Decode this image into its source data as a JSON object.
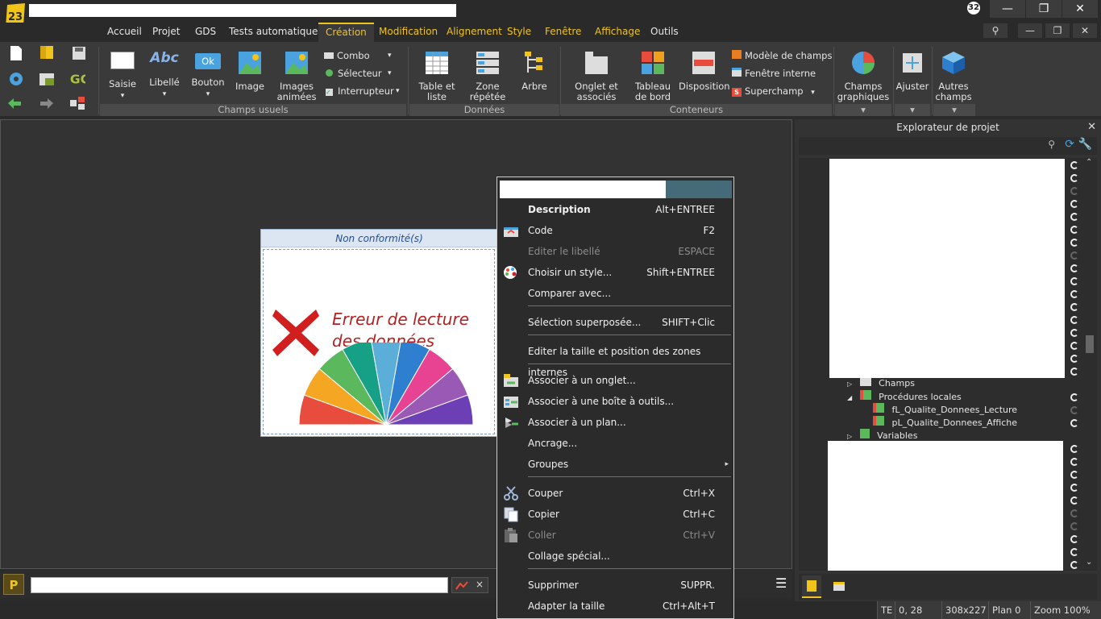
{
  "titlebar": {
    "logo_text": "23",
    "notification_count": "32"
  },
  "menu": {
    "tabs": [
      {
        "label": "Accueil",
        "style": "normal"
      },
      {
        "label": "Projet",
        "style": "normal"
      },
      {
        "label": "GDS",
        "style": "normal"
      },
      {
        "label": "Tests automatiques",
        "style": "normal"
      },
      {
        "label": "Création",
        "style": "active"
      },
      {
        "label": "Modification",
        "style": "yellow"
      },
      {
        "label": "Alignement",
        "style": "yellow"
      },
      {
        "label": "Style",
        "style": "yellow"
      },
      {
        "label": "Fenêtre",
        "style": "yellow"
      },
      {
        "label": "Affichage",
        "style": "yellow"
      },
      {
        "label": "Outils",
        "style": "normal"
      }
    ]
  },
  "ribbon": {
    "saisie": "Saisie",
    "libelle": "Libellé",
    "libelle_icon_text": "Abc",
    "bouton": "Bouton",
    "bouton_icon_text": "Ok",
    "image": "Image",
    "images_animees": "Images animées",
    "combo": "Combo",
    "selecteur": "Sélecteur",
    "interrupteur": "Interrupteur",
    "group_champs_usuels": "Champs usuels",
    "table_et_liste": "Table et liste",
    "zone_repetee": "Zone répétée",
    "arbre": "Arbre",
    "group_donnees": "Données",
    "onglet_et_associes": "Onglet et associés",
    "tableau_de_bord": "Tableau de bord",
    "disposition": "Disposition",
    "modele_de_champs": "Modèle de champs",
    "fenetre_interne": "Fenêtre interne",
    "superchamp": "Superchamp",
    "group_conteneurs": "Conteneurs",
    "champs_graphiques": "Champs graphiques",
    "ajuster": "Ajuster",
    "autres_champs": "Autres champs",
    "go_label": "GO"
  },
  "editor": {
    "window_title": "Non conformité(s)",
    "error_line1": "Erreur de lecture",
    "error_line2": "des données",
    "pie_colors": [
      "#e84c3d",
      "#f5a623",
      "#5cb85c",
      "#16a085",
      "#5aaed8",
      "#2f7fd1",
      "#e84393",
      "#9b59b6",
      "#6c3fb5"
    ]
  },
  "bottom": {
    "p_label": "P",
    "close": "×"
  },
  "statusbar": {
    "te": "TE",
    "coords": "0, 28",
    "size": "308x227",
    "plan": "Plan 0",
    "zoom": "Zoom 100%"
  },
  "explorer": {
    "title": "Explorateur de projet",
    "tree": [
      {
        "label": "Champs",
        "level": 0
      },
      {
        "label": "Procédures locales",
        "level": 0
      },
      {
        "label": "fL_Qualite_Donnees_Lecture",
        "level": 1
      },
      {
        "label": "pL_Qualite_Donnees_Affiche",
        "level": 1
      },
      {
        "label": "Variables",
        "level": 0
      }
    ]
  },
  "context_menu": {
    "items": [
      {
        "label": "Description",
        "shortcut": "Alt+ENTREE",
        "state": "bold",
        "icon": ""
      },
      {
        "label": "Code",
        "shortcut": "F2",
        "state": "normal",
        "icon": "code-icon"
      },
      {
        "label": "Editer le libellé",
        "shortcut": "ESPACE",
        "state": "disabled",
        "icon": ""
      },
      {
        "label": "Choisir un style...",
        "shortcut": "Shift+ENTREE",
        "state": "normal",
        "icon": "palette-icon"
      },
      {
        "label": "Comparer avec...",
        "shortcut": "",
        "state": "normal",
        "icon": ""
      },
      {
        "label": "Sélection superposée...",
        "shortcut": "SHIFT+Clic",
        "state": "normal",
        "icon": ""
      },
      {
        "label": "Editer la taille et position des zones internes",
        "shortcut": "",
        "state": "normal",
        "icon": ""
      },
      {
        "label": "Associer à un onglet...",
        "shortcut": "",
        "state": "normal",
        "icon": "tab-icon"
      },
      {
        "label": "Associer à une boîte à outils...",
        "shortcut": "",
        "state": "normal",
        "icon": "toolbox-icon"
      },
      {
        "label": "Associer à un plan...",
        "shortcut": "",
        "state": "normal",
        "icon": "plan-icon"
      },
      {
        "label": "Ancrage...",
        "shortcut": "",
        "state": "normal",
        "icon": ""
      },
      {
        "label": "Groupes",
        "shortcut": "",
        "state": "normal",
        "icon": ""
      },
      {
        "label": "Couper",
        "shortcut": "Ctrl+X",
        "state": "normal",
        "icon": "scissors-icon"
      },
      {
        "label": "Copier",
        "shortcut": "Ctrl+C",
        "state": "normal",
        "icon": "copy-icon"
      },
      {
        "label": "Coller",
        "shortcut": "Ctrl+V",
        "state": "disabled",
        "icon": "paste-icon"
      },
      {
        "label": "Collage spécial...",
        "shortcut": "",
        "state": "normal",
        "icon": ""
      },
      {
        "label": "Supprimer",
        "shortcut": "SUPPR.",
        "state": "normal",
        "icon": ""
      },
      {
        "label": "Adapter la taille",
        "shortcut": "Ctrl+Alt+T",
        "state": "normal",
        "icon": ""
      }
    ]
  }
}
